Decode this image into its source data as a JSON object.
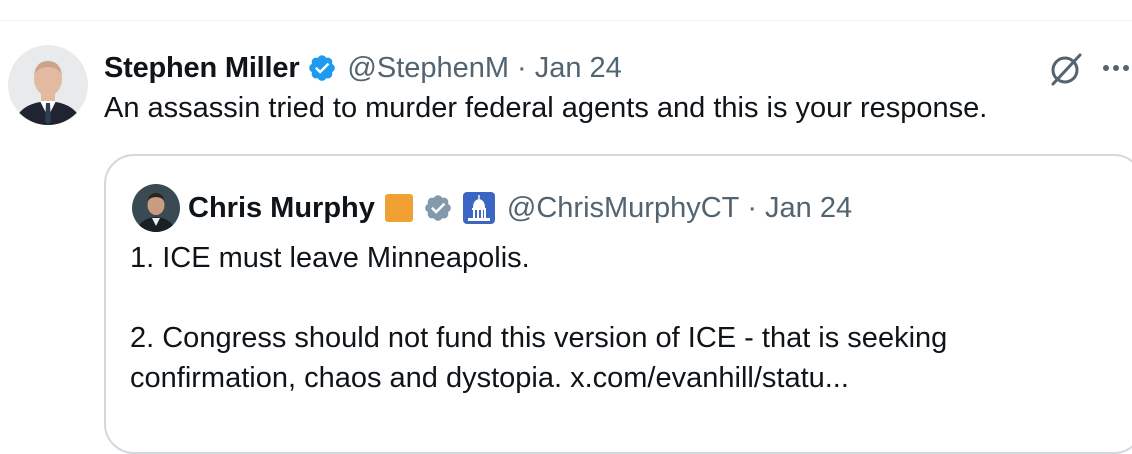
{
  "tweet": {
    "author_name": "Stephen Miller",
    "handle": "@StephenM",
    "separator": "·",
    "date": "Jan 24",
    "text": "An assassin tried to murder federal agents and this is your response."
  },
  "quoted_tweet": {
    "author_name": "Chris Murphy",
    "handle": "@ChrisMurphyCT",
    "separator": "·",
    "date": "Jan 24",
    "lines": [
      "1. ICE must leave Minneapolis.",
      "2. Congress should not fund this version of ICE - that is seeking",
      "confirmation, chaos and dystopia. x.com/evanhill/statu..."
    ]
  },
  "icons": {
    "verified_badge": "verified-badge-icon",
    "gray_badge": "gray-verified-badge-icon",
    "capitol": "capitol-emoji-icon",
    "grok": "grok-icon",
    "more": "more-options-icon",
    "orange_square": "orange-square-emoji"
  },
  "colors": {
    "verified_blue": "#1d9bf0",
    "government_gray": "#829aab",
    "orange_square": "#f0a132",
    "secondary_text": "#536471",
    "border": "#cfd9de"
  }
}
